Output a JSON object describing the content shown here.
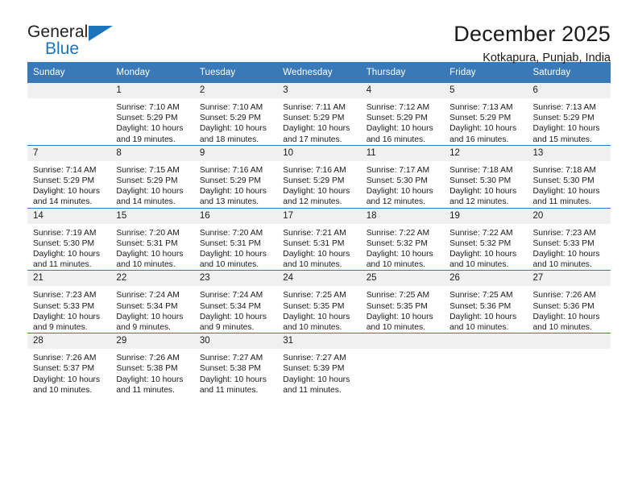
{
  "brand": {
    "line1": "General",
    "line2": "Blue",
    "logo_icon": "triangle-logo-icon",
    "accent_color": "#1b74bc"
  },
  "header": {
    "title": "December 2025",
    "subtitle": "Kotkapura, Punjab, India"
  },
  "theme": {
    "header_row_color": "#3a79b8",
    "date_band_color": "#f0f0f0",
    "text_color": "#1a1a1a"
  },
  "calendar": {
    "weekday_headers": [
      "Sunday",
      "Monday",
      "Tuesday",
      "Wednesday",
      "Thursday",
      "Friday",
      "Saturday"
    ],
    "weeks": [
      [
        {
          "day": "",
          "sunrise": "",
          "sunset": "",
          "daylight1": "",
          "daylight2": ""
        },
        {
          "day": "1",
          "sunrise": "Sunrise: 7:10 AM",
          "sunset": "Sunset: 5:29 PM",
          "daylight1": "Daylight: 10 hours",
          "daylight2": "and 19 minutes."
        },
        {
          "day": "2",
          "sunrise": "Sunrise: 7:10 AM",
          "sunset": "Sunset: 5:29 PM",
          "daylight1": "Daylight: 10 hours",
          "daylight2": "and 18 minutes."
        },
        {
          "day": "3",
          "sunrise": "Sunrise: 7:11 AM",
          "sunset": "Sunset: 5:29 PM",
          "daylight1": "Daylight: 10 hours",
          "daylight2": "and 17 minutes."
        },
        {
          "day": "4",
          "sunrise": "Sunrise: 7:12 AM",
          "sunset": "Sunset: 5:29 PM",
          "daylight1": "Daylight: 10 hours",
          "daylight2": "and 16 minutes."
        },
        {
          "day": "5",
          "sunrise": "Sunrise: 7:13 AM",
          "sunset": "Sunset: 5:29 PM",
          "daylight1": "Daylight: 10 hours",
          "daylight2": "and 16 minutes."
        },
        {
          "day": "6",
          "sunrise": "Sunrise: 7:13 AM",
          "sunset": "Sunset: 5:29 PM",
          "daylight1": "Daylight: 10 hours",
          "daylight2": "and 15 minutes."
        }
      ],
      [
        {
          "day": "7",
          "sunrise": "Sunrise: 7:14 AM",
          "sunset": "Sunset: 5:29 PM",
          "daylight1": "Daylight: 10 hours",
          "daylight2": "and 14 minutes."
        },
        {
          "day": "8",
          "sunrise": "Sunrise: 7:15 AM",
          "sunset": "Sunset: 5:29 PM",
          "daylight1": "Daylight: 10 hours",
          "daylight2": "and 14 minutes."
        },
        {
          "day": "9",
          "sunrise": "Sunrise: 7:16 AM",
          "sunset": "Sunset: 5:29 PM",
          "daylight1": "Daylight: 10 hours",
          "daylight2": "and 13 minutes."
        },
        {
          "day": "10",
          "sunrise": "Sunrise: 7:16 AM",
          "sunset": "Sunset: 5:29 PM",
          "daylight1": "Daylight: 10 hours",
          "daylight2": "and 12 minutes."
        },
        {
          "day": "11",
          "sunrise": "Sunrise: 7:17 AM",
          "sunset": "Sunset: 5:30 PM",
          "daylight1": "Daylight: 10 hours",
          "daylight2": "and 12 minutes."
        },
        {
          "day": "12",
          "sunrise": "Sunrise: 7:18 AM",
          "sunset": "Sunset: 5:30 PM",
          "daylight1": "Daylight: 10 hours",
          "daylight2": "and 12 minutes."
        },
        {
          "day": "13",
          "sunrise": "Sunrise: 7:18 AM",
          "sunset": "Sunset: 5:30 PM",
          "daylight1": "Daylight: 10 hours",
          "daylight2": "and 11 minutes."
        }
      ],
      [
        {
          "day": "14",
          "sunrise": "Sunrise: 7:19 AM",
          "sunset": "Sunset: 5:30 PM",
          "daylight1": "Daylight: 10 hours",
          "daylight2": "and 11 minutes."
        },
        {
          "day": "15",
          "sunrise": "Sunrise: 7:20 AM",
          "sunset": "Sunset: 5:31 PM",
          "daylight1": "Daylight: 10 hours",
          "daylight2": "and 10 minutes."
        },
        {
          "day": "16",
          "sunrise": "Sunrise: 7:20 AM",
          "sunset": "Sunset: 5:31 PM",
          "daylight1": "Daylight: 10 hours",
          "daylight2": "and 10 minutes."
        },
        {
          "day": "17",
          "sunrise": "Sunrise: 7:21 AM",
          "sunset": "Sunset: 5:31 PM",
          "daylight1": "Daylight: 10 hours",
          "daylight2": "and 10 minutes."
        },
        {
          "day": "18",
          "sunrise": "Sunrise: 7:22 AM",
          "sunset": "Sunset: 5:32 PM",
          "daylight1": "Daylight: 10 hours",
          "daylight2": "and 10 minutes."
        },
        {
          "day": "19",
          "sunrise": "Sunrise: 7:22 AM",
          "sunset": "Sunset: 5:32 PM",
          "daylight1": "Daylight: 10 hours",
          "daylight2": "and 10 minutes."
        },
        {
          "day": "20",
          "sunrise": "Sunrise: 7:23 AM",
          "sunset": "Sunset: 5:33 PM",
          "daylight1": "Daylight: 10 hours",
          "daylight2": "and 10 minutes."
        }
      ],
      [
        {
          "day": "21",
          "sunrise": "Sunrise: 7:23 AM",
          "sunset": "Sunset: 5:33 PM",
          "daylight1": "Daylight: 10 hours",
          "daylight2": "and 9 minutes."
        },
        {
          "day": "22",
          "sunrise": "Sunrise: 7:24 AM",
          "sunset": "Sunset: 5:34 PM",
          "daylight1": "Daylight: 10 hours",
          "daylight2": "and 9 minutes."
        },
        {
          "day": "23",
          "sunrise": "Sunrise: 7:24 AM",
          "sunset": "Sunset: 5:34 PM",
          "daylight1": "Daylight: 10 hours",
          "daylight2": "and 9 minutes."
        },
        {
          "day": "24",
          "sunrise": "Sunrise: 7:25 AM",
          "sunset": "Sunset: 5:35 PM",
          "daylight1": "Daylight: 10 hours",
          "daylight2": "and 10 minutes."
        },
        {
          "day": "25",
          "sunrise": "Sunrise: 7:25 AM",
          "sunset": "Sunset: 5:35 PM",
          "daylight1": "Daylight: 10 hours",
          "daylight2": "and 10 minutes."
        },
        {
          "day": "26",
          "sunrise": "Sunrise: 7:25 AM",
          "sunset": "Sunset: 5:36 PM",
          "daylight1": "Daylight: 10 hours",
          "daylight2": "and 10 minutes."
        },
        {
          "day": "27",
          "sunrise": "Sunrise: 7:26 AM",
          "sunset": "Sunset: 5:36 PM",
          "daylight1": "Daylight: 10 hours",
          "daylight2": "and 10 minutes."
        }
      ],
      [
        {
          "day": "28",
          "sunrise": "Sunrise: 7:26 AM",
          "sunset": "Sunset: 5:37 PM",
          "daylight1": "Daylight: 10 hours",
          "daylight2": "and 10 minutes."
        },
        {
          "day": "29",
          "sunrise": "Sunrise: 7:26 AM",
          "sunset": "Sunset: 5:38 PM",
          "daylight1": "Daylight: 10 hours",
          "daylight2": "and 11 minutes."
        },
        {
          "day": "30",
          "sunrise": "Sunrise: 7:27 AM",
          "sunset": "Sunset: 5:38 PM",
          "daylight1": "Daylight: 10 hours",
          "daylight2": "and 11 minutes."
        },
        {
          "day": "31",
          "sunrise": "Sunrise: 7:27 AM",
          "sunset": "Sunset: 5:39 PM",
          "daylight1": "Daylight: 10 hours",
          "daylight2": "and 11 minutes."
        },
        {
          "day": "",
          "sunrise": "",
          "sunset": "",
          "daylight1": "",
          "daylight2": ""
        },
        {
          "day": "",
          "sunrise": "",
          "sunset": "",
          "daylight1": "",
          "daylight2": ""
        },
        {
          "day": "",
          "sunrise": "",
          "sunset": "",
          "daylight1": "",
          "daylight2": ""
        }
      ]
    ]
  }
}
